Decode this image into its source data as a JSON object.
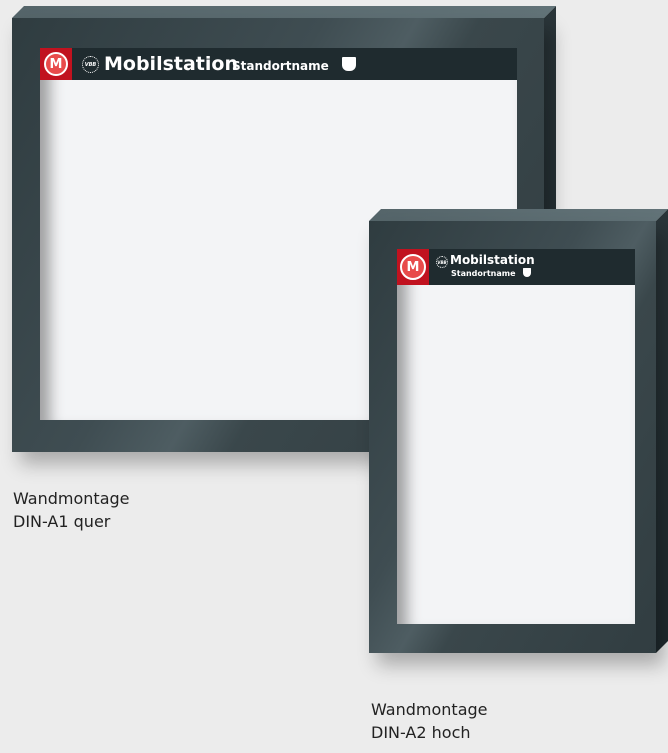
{
  "frame_a1": {
    "logo_letter": "M",
    "vbb_label": "VBB",
    "title": "Mobilstation",
    "subtitle": "Standortname"
  },
  "frame_a2": {
    "logo_letter": "M",
    "vbb_label": "VBB",
    "title": "Mobilstation",
    "subtitle": "Standortname"
  },
  "captions": {
    "a1_line1": "Wandmontage",
    "a1_line2": "DIN-A1 quer",
    "a2_line1": "Wandmontage",
    "a2_line2": "DIN-A2 hoch"
  },
  "colors": {
    "brand_red": "#c1121f",
    "frame": "#3f4d52",
    "header": "#1f2b2f"
  }
}
